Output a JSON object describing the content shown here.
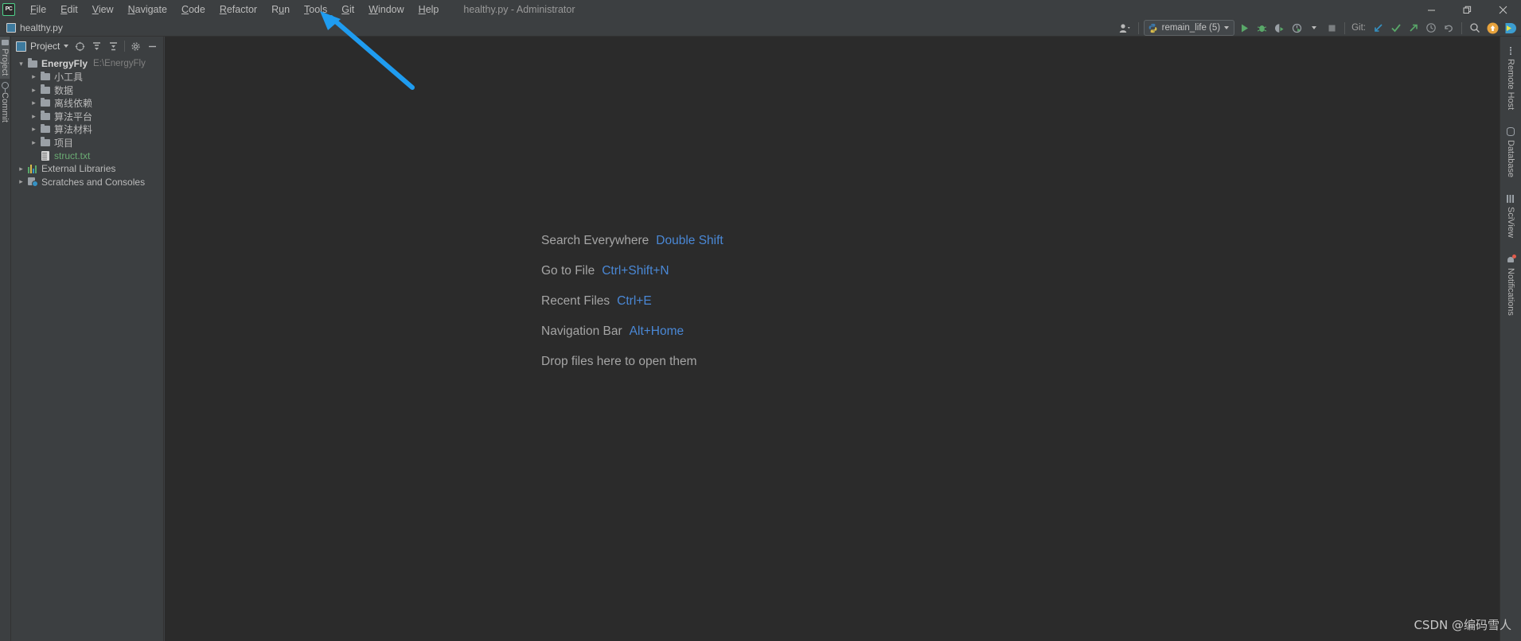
{
  "titlebar": {
    "logo_text": "PC",
    "window_title": "healthy.py - Administrator",
    "menus": [
      {
        "label": "File",
        "mnemonic": "F"
      },
      {
        "label": "Edit",
        "mnemonic": "E"
      },
      {
        "label": "View",
        "mnemonic": "V"
      },
      {
        "label": "Navigate",
        "mnemonic": "N"
      },
      {
        "label": "Code",
        "mnemonic": "C"
      },
      {
        "label": "Refactor",
        "mnemonic": "R"
      },
      {
        "label": "Run",
        "mnemonic": "u"
      },
      {
        "label": "Tools",
        "mnemonic": "T"
      },
      {
        "label": "Git",
        "mnemonic": "G"
      },
      {
        "label": "Window",
        "mnemonic": "W"
      },
      {
        "label": "Help",
        "mnemonic": "H"
      }
    ],
    "controls": {
      "minimize": "minimize-icon",
      "restore": "restore-icon",
      "close": "close-icon"
    }
  },
  "tabstrip": {
    "open_file": "healthy.py",
    "file_icon": "python-file-icon",
    "run_config": {
      "name": "remain_life (5)",
      "icon": "python-icon"
    },
    "git_label": "Git:",
    "actions": {
      "user_icon": "user-account-icon",
      "run": "run-icon",
      "debug": "debug-icon",
      "coverage": "run-with-coverage-icon",
      "profile": "profile-icon",
      "stop": "stop-icon",
      "update": "git-update-project-icon",
      "commit": "git-commit-icon",
      "push": "git-push-icon",
      "history": "git-history-icon",
      "rollback": "git-rollback-icon",
      "search": "search-icon",
      "update_available": "update-available-icon",
      "ide_assist": "ide-assist-icon"
    }
  },
  "left_rail": {
    "tabs": [
      {
        "label": "Project",
        "icon": "project-folder-icon",
        "active": true
      },
      {
        "label": "Commit",
        "icon": "commit-icon",
        "active": false
      }
    ]
  },
  "project_panel": {
    "title": "Project",
    "icon": "project-icon",
    "header_buttons": [
      {
        "name": "select-opened-file-icon"
      },
      {
        "name": "expand-all-icon"
      },
      {
        "name": "collapse-all-icon"
      },
      {
        "name": "settings-gear-icon"
      },
      {
        "name": "hide-panel-icon"
      }
    ],
    "tree": [
      {
        "label": "EnergyFly",
        "path": "E:\\EnergyFly",
        "icon": "folder-icon",
        "expanded": true,
        "depth": 0,
        "bold": true
      },
      {
        "label": "小工具",
        "icon": "folder-icon",
        "expanded": false,
        "depth": 1
      },
      {
        "label": "数据",
        "icon": "folder-icon",
        "expanded": false,
        "depth": 1
      },
      {
        "label": "离线依赖",
        "icon": "folder-icon",
        "expanded": false,
        "depth": 1
      },
      {
        "label": "算法平台",
        "icon": "folder-icon",
        "expanded": false,
        "depth": 1
      },
      {
        "label": "算法材料",
        "icon": "folder-icon",
        "expanded": false,
        "depth": 1
      },
      {
        "label": "项目",
        "icon": "folder-icon",
        "expanded": false,
        "depth": 1
      },
      {
        "label": "struct.txt",
        "icon": "text-file-icon",
        "depth": 1,
        "color": "#6aab73"
      },
      {
        "label": "External Libraries",
        "icon": "external-libraries-icon",
        "expanded": false,
        "depth": 0
      },
      {
        "label": "Scratches and Consoles",
        "icon": "scratches-icon",
        "expanded": false,
        "depth": 0
      }
    ]
  },
  "editor": {
    "hints": [
      {
        "action": "Search Everywhere",
        "key": "Double Shift"
      },
      {
        "action": "Go to File",
        "key": "Ctrl+Shift+N"
      },
      {
        "action": "Recent Files",
        "key": "Ctrl+E"
      },
      {
        "action": "Navigation Bar",
        "key": "Alt+Home"
      }
    ],
    "drop_hint": "Drop files here to open them"
  },
  "right_rail": {
    "tabs": [
      {
        "label": "Remote Host",
        "icon": "remote-host-icon"
      },
      {
        "label": "Database",
        "icon": "database-icon"
      },
      {
        "label": "SciView",
        "icon": "sciview-icon"
      },
      {
        "label": "Notifications",
        "icon": "notifications-bell-icon"
      }
    ]
  },
  "watermark": "CSDN @编码雪人",
  "colors": {
    "accent_blue": "#4a88d6",
    "arrow_blue": "#1f9cf0",
    "new_file_green": "#6aab73",
    "panel_bg": "#3c3f41",
    "editor_bg": "#2b2b2b"
  }
}
